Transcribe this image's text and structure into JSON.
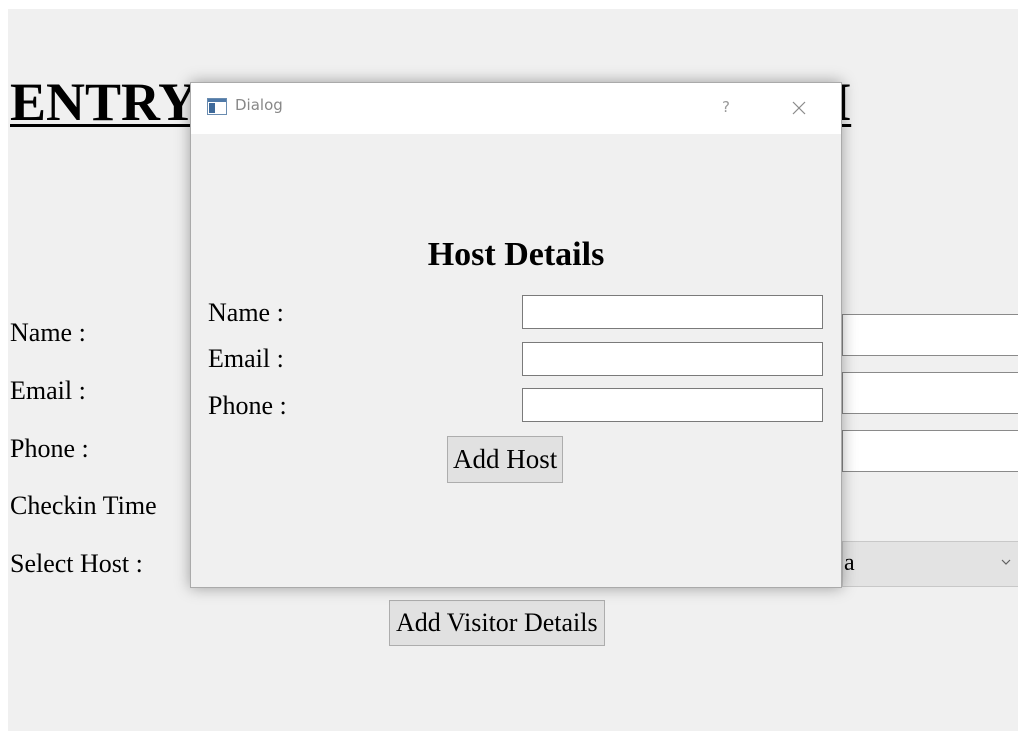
{
  "main_window": {
    "title": "ENTRY MANAGEMENT SYSTEM",
    "fields": [
      {
        "label": "Name :",
        "value": ""
      },
      {
        "label": "Email :",
        "value": ""
      },
      {
        "label": "Phone :",
        "value": ""
      },
      {
        "label": "Checkin Time",
        "value": ""
      }
    ],
    "select_host": {
      "label": "Select Host :",
      "visible_value_fragment": "a"
    },
    "add_visitor_button": "Add Visitor Details"
  },
  "dialog": {
    "title": "Dialog",
    "help_glyph": "?",
    "heading": "Host Details",
    "fields": [
      {
        "label": "Name :",
        "value": ""
      },
      {
        "label": "Email :",
        "value": ""
      },
      {
        "label": "Phone :",
        "value": ""
      }
    ],
    "add_button": "Add Host"
  },
  "colors": {
    "window_bg": "#f0f0f0",
    "titlebar_bg": "#ffffff",
    "button_bg": "#e1e1e1",
    "input_border": "#7a7a7a",
    "title_text": "#888888"
  },
  "icons": {
    "app": "window-app-icon",
    "help": "help-icon",
    "close": "close-icon",
    "dropdown": "chevron-down-icon"
  }
}
